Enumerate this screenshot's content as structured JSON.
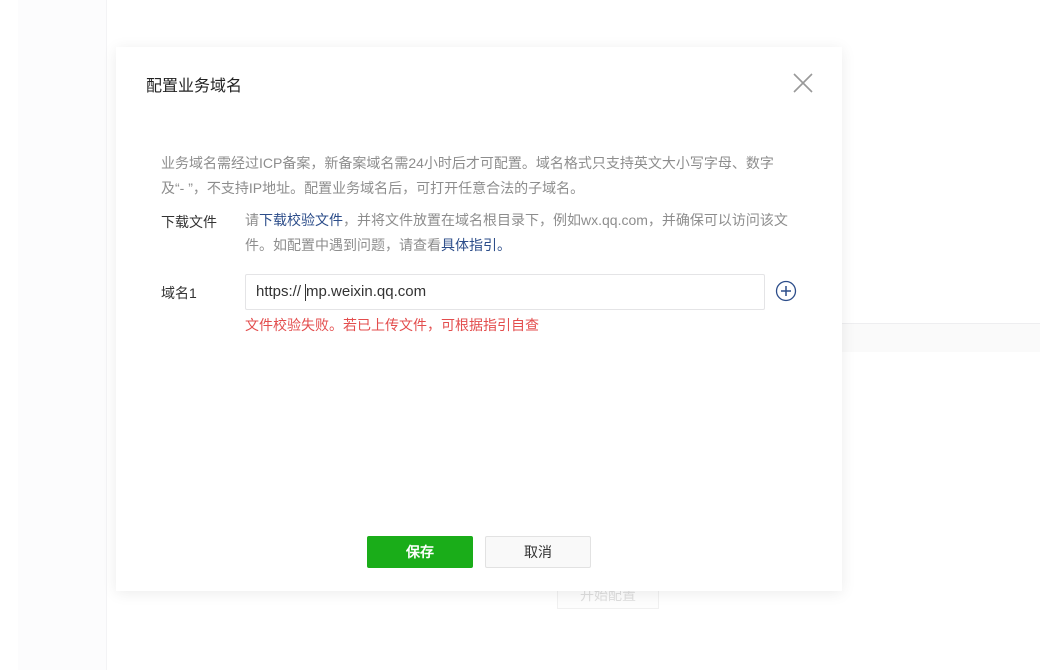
{
  "background": {
    "start_button": "开始配置"
  },
  "modal": {
    "title": "配置业务域名",
    "description": "业务域名需经过ICP备案，新备案域名需24小时后才可配置。域名格式只支持英文大小写字母、数字及“- ”，不支持IP地址。配置业务域名后，可打开任意合法的子域名。",
    "download": {
      "label": "下载文件",
      "text_before": "请",
      "link1": "下载校验文件",
      "text_middle": "，并将文件放置在域名根目录下，例如wx.qq.com，并确保可以访问该文件。如配置中遇到问题，请查看",
      "link2": "具体指引。"
    },
    "domain": {
      "label": "域名1",
      "prefix": "https://",
      "value": "mp.weixin.qq.com",
      "error": "文件校验失败。若已上传文件，可根据指引自查"
    },
    "save_label": "保存",
    "cancel_label": "取消",
    "colors": {
      "primary": "#1aad19",
      "error": "#e34d4d",
      "link": "#2c4d8a"
    }
  }
}
